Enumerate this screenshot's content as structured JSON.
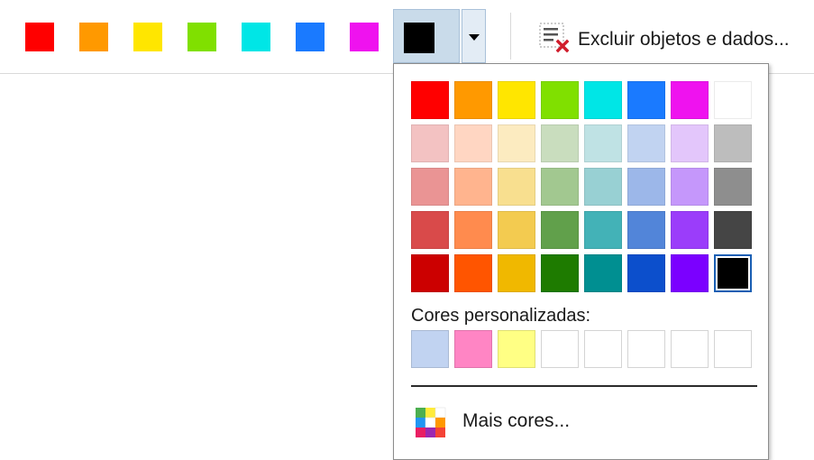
{
  "toolbar": {
    "quick_colors": [
      {
        "name": "red",
        "color": "#ff0000"
      },
      {
        "name": "orange",
        "color": "#ff9900"
      },
      {
        "name": "yellow",
        "color": "#ffe600"
      },
      {
        "name": "green",
        "color": "#80e000"
      },
      {
        "name": "cyan",
        "color": "#00e6e6"
      },
      {
        "name": "blue",
        "color": "#1a7aff"
      },
      {
        "name": "magenta",
        "color": "#ef12ef"
      }
    ],
    "selected_color": "#000000",
    "dropdown_icon": "chevron-down-icon",
    "excluir": {
      "label": "Excluir objetos e dados...",
      "icon": "delete-list-icon"
    }
  },
  "color_picker": {
    "grid": [
      [
        "#ff0000",
        "#ff9900",
        "#ffe600",
        "#80e000",
        "#00e6e6",
        "#1a7aff",
        "#ef12ef",
        "#ffffff"
      ],
      [
        "#f3c2c2",
        "#ffd6c2",
        "#fcebc0",
        "#c9ddbe",
        "#bfe2e4",
        "#c1d3f1",
        "#e3c6fb",
        "#bdbdbd"
      ],
      [
        "#ea9494",
        "#ffb48e",
        "#f8df8f",
        "#a2c890",
        "#98d0d3",
        "#9cb7e9",
        "#c597fb",
        "#8e8e8e"
      ],
      [
        "#d94a4a",
        "#ff8b4e",
        "#f3cb50",
        "#61a04b",
        "#43b2b7",
        "#5285d9",
        "#9b3dfa",
        "#454545"
      ],
      [
        "#cc0000",
        "#ff5500",
        "#f0b800",
        "#1e7b00",
        "#008f91",
        "#0c4fcc",
        "#7b00ff",
        "#000000"
      ]
    ],
    "selected_index": [
      4,
      7
    ],
    "custom_colors_label": "Cores personalizadas:",
    "custom_colors": [
      "#c1d3f1",
      "#ff85c4",
      "#ffff84",
      "",
      "",
      "",
      "",
      ""
    ],
    "more_colors_label": "Mais cores...",
    "more_colors_icon": "color-palette-icon"
  }
}
